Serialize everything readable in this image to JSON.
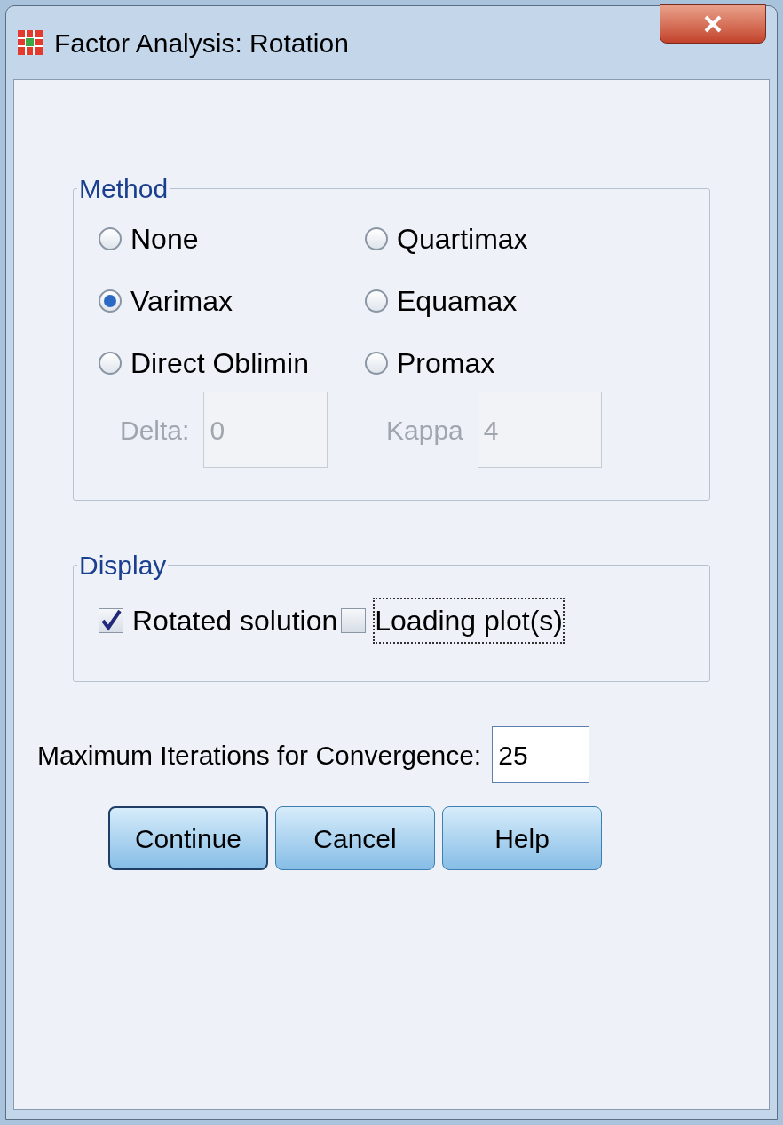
{
  "window": {
    "title": "Factor Analysis: Rotation"
  },
  "method": {
    "title": "Method",
    "options": [
      {
        "label": "None",
        "selected": false
      },
      {
        "label": "Quartimax",
        "selected": false
      },
      {
        "label": "Varimax",
        "selected": true
      },
      {
        "label": "Equamax",
        "selected": false
      },
      {
        "label": "Direct Oblimin",
        "selected": false
      },
      {
        "label": "Promax",
        "selected": false
      }
    ],
    "params": [
      {
        "label": "Delta:",
        "value": "0",
        "disabled": true
      },
      {
        "label": "Kappa",
        "value": "4",
        "disabled": true
      }
    ]
  },
  "display": {
    "title": "Display",
    "checks": [
      {
        "label": "Rotated solution",
        "checked": true,
        "focused": false
      },
      {
        "label": "Loading plot(s)",
        "checked": false,
        "focused": true
      }
    ]
  },
  "iterations": {
    "label": "Maximum Iterations for Convergence:",
    "value": "25"
  },
  "buttons": [
    {
      "label": "Continue",
      "default": true
    },
    {
      "label": "Cancel",
      "default": false
    },
    {
      "label": "Help",
      "default": false
    }
  ]
}
